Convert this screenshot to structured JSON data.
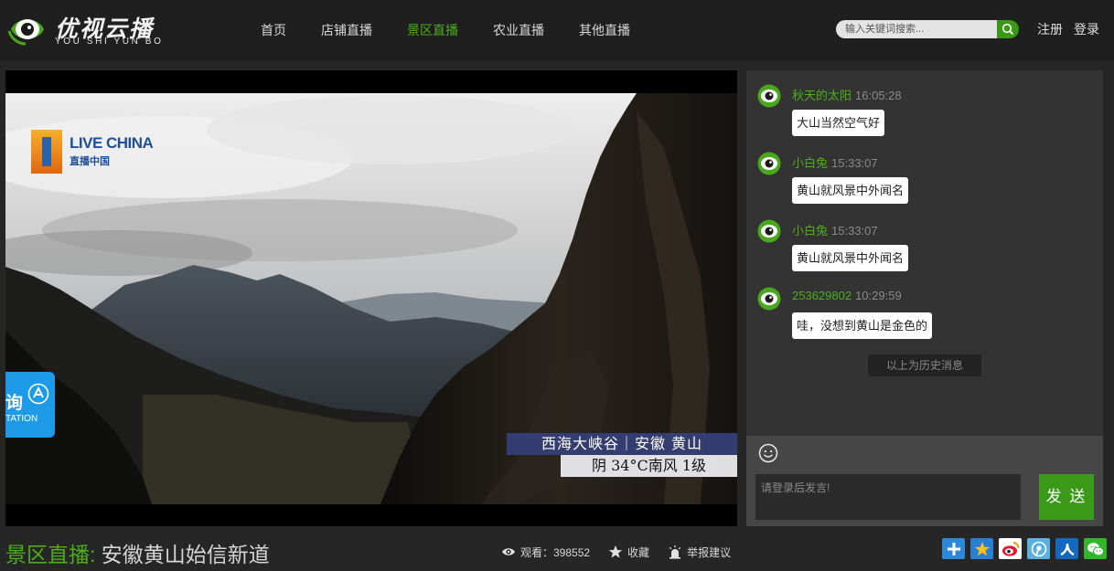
{
  "header": {
    "logo_cn": "优视云播",
    "logo_en": "YOU SHI YUN BO",
    "nav": [
      {
        "label": "首页",
        "active": false
      },
      {
        "label": "店铺直播",
        "active": false
      },
      {
        "label": "景区直播",
        "active": true
      },
      {
        "label": "农业直播",
        "active": false
      },
      {
        "label": "其他直播",
        "active": false
      }
    ],
    "search_placeholder": "输入关键词搜索...",
    "register": "注册",
    "login": "登录"
  },
  "player": {
    "watermark_en": "LIVE CHINA",
    "watermark_cn": "直播中国",
    "caption_location": "西海大峡谷｜安徽 黄山",
    "caption_weather": "阴  34°C南风 1级",
    "consult_cn": "询",
    "consult_en": "TATION"
  },
  "chat": {
    "messages": [
      {
        "user": "秋天的太阳",
        "time": "16:05:28",
        "text": "大山当然空气好"
      },
      {
        "user": "小白兔",
        "time": "15:33:07",
        "text": "黄山就风景中外闻名"
      },
      {
        "user": "小白兔",
        "time": "15:33:07",
        "text": "黄山就风景中外闻名"
      },
      {
        "user": "253629802",
        "time": "10:29:59",
        "text": "哇，没想到黄山是金色的"
      }
    ],
    "history_label": "以上为历史消息",
    "input_placeholder": "请登录后发言!",
    "send_label": "发 送"
  },
  "footer": {
    "category": "景区直播:",
    "title": " 安徽黄山始信新道",
    "views_label": "观看：398552",
    "favorite_label": "收藏",
    "report_label": "举报建议",
    "share_icons": [
      "add-share",
      "qzone",
      "weibo",
      "tencent-weibo",
      "renren",
      "wechat"
    ]
  },
  "colors": {
    "accent": "#4cae1c",
    "button_green": "#3a9a18",
    "header_bg": "#1f1f1f",
    "page_bg": "#262626",
    "chat_bg": "#333333"
  }
}
